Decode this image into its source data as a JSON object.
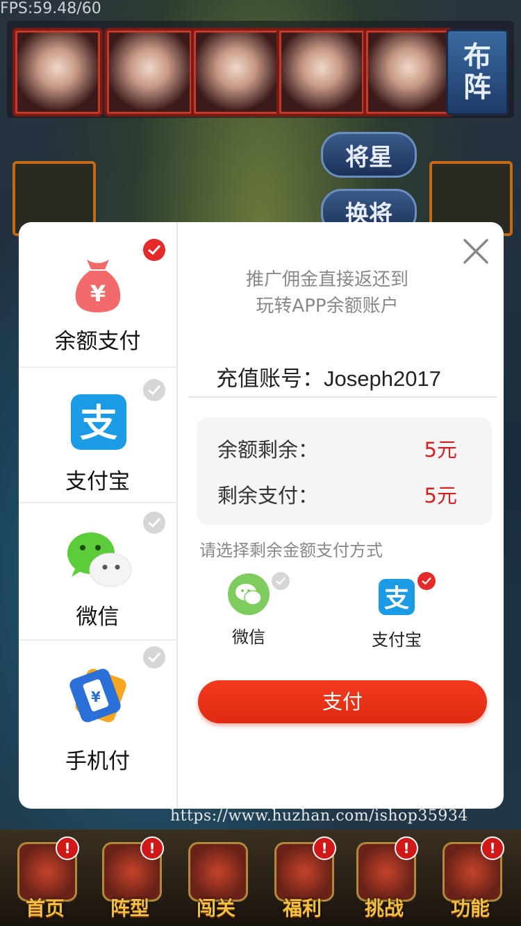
{
  "hud": {
    "fps": "FPS:59.48/60"
  },
  "formation": {
    "buzhen_top": "布",
    "buzhen_bottom": "阵",
    "btn_jiangxing": "将星",
    "btn_huanjiang": "换将"
  },
  "dialog": {
    "methods": [
      {
        "label": "余额支付",
        "icon": "balance-bag-icon",
        "selected": true
      },
      {
        "label": "支付宝",
        "icon": "alipay-icon",
        "selected": false
      },
      {
        "label": "微信",
        "icon": "wechat-icon",
        "selected": false
      },
      {
        "label": "手机付",
        "icon": "mobile-pay-icon",
        "selected": false
      }
    ],
    "promo_line1": "推广佣金直接返还到",
    "promo_line2": "玩转APP余额账户",
    "account_label": "充值账号：",
    "account_value": "Joseph2017",
    "balance_label": "余额剩余：",
    "balance_value": "5元",
    "remaining_label": "剩余支付：",
    "remaining_value": "5元",
    "choose_hint": "请选择剩余金额支付方式",
    "sub_methods": [
      {
        "label": "微信",
        "selected": false
      },
      {
        "label": "支付宝",
        "selected": true
      }
    ],
    "pay_button": "支付",
    "accent_color": "#e52a2a"
  },
  "watermark": "https://www.huzhan.com/ishop35934",
  "nav": [
    {
      "label": "首页",
      "badge": "!"
    },
    {
      "label": "阵型",
      "badge": "!"
    },
    {
      "label": "闯关",
      "badge": ""
    },
    {
      "label": "福利",
      "badge": "!"
    },
    {
      "label": "挑战",
      "badge": "!"
    },
    {
      "label": "功能",
      "badge": "!"
    }
  ]
}
